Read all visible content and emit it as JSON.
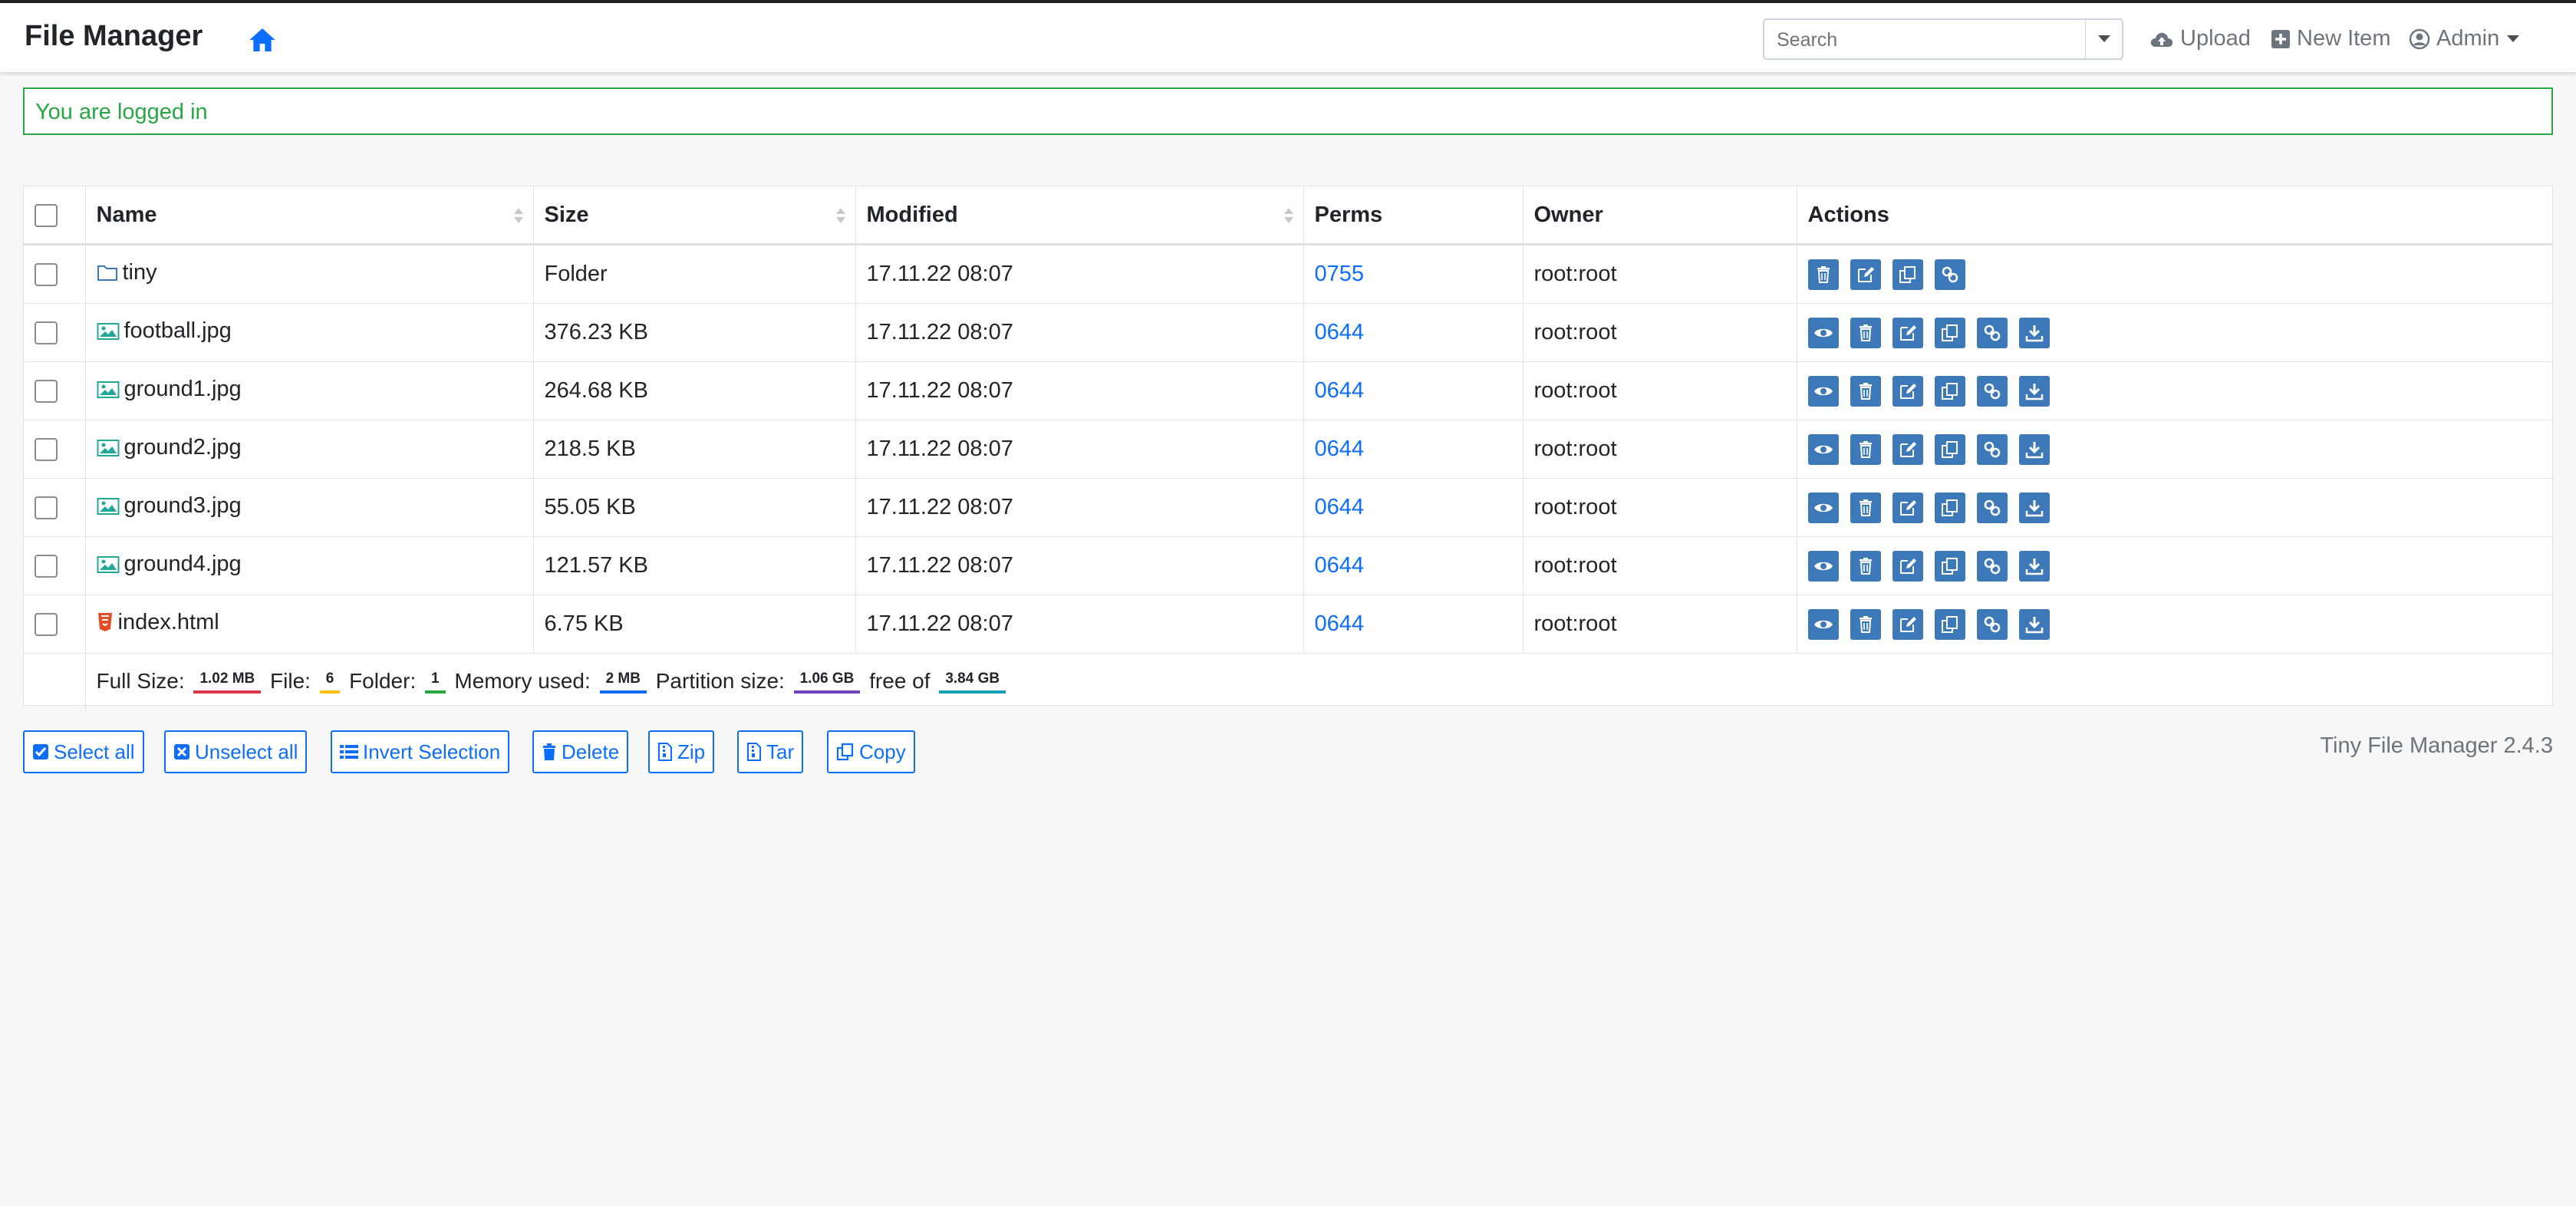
{
  "navbar": {
    "brand": "File Manager",
    "search_placeholder": "Search",
    "upload": "Upload",
    "new_item": "New Item",
    "user": "Admin"
  },
  "alert": {
    "message": "You are logged in"
  },
  "table": {
    "columns": [
      "Name",
      "Size",
      "Modified",
      "Perms",
      "Owner",
      "Actions"
    ],
    "rows": [
      {
        "name": "tiny",
        "type": "folder",
        "size": "Folder",
        "modified": "17.11.22 08:07",
        "perms": "0755",
        "owner": "root:root"
      },
      {
        "name": "football.jpg",
        "type": "image",
        "size": "376.23 KB",
        "modified": "17.11.22 08:07",
        "perms": "0644",
        "owner": "root:root"
      },
      {
        "name": "ground1.jpg",
        "type": "image",
        "size": "264.68 KB",
        "modified": "17.11.22 08:07",
        "perms": "0644",
        "owner": "root:root"
      },
      {
        "name": "ground2.jpg",
        "type": "image",
        "size": "218.5 KB",
        "modified": "17.11.22 08:07",
        "perms": "0644",
        "owner": "root:root"
      },
      {
        "name": "ground3.jpg",
        "type": "image",
        "size": "55.05 KB",
        "modified": "17.11.22 08:07",
        "perms": "0644",
        "owner": "root:root"
      },
      {
        "name": "ground4.jpg",
        "type": "image",
        "size": "121.57 KB",
        "modified": "17.11.22 08:07",
        "perms": "0644",
        "owner": "root:root"
      },
      {
        "name": "index.html",
        "type": "html",
        "size": "6.75 KB",
        "modified": "17.11.22 08:07",
        "perms": "0644",
        "owner": "root:root"
      }
    ],
    "footer": {
      "full_size_label": "Full Size:",
      "full_size": "1.02 MB",
      "file_label": "File:",
      "file_count": "6",
      "folder_label": "Folder:",
      "folder_count": "1",
      "memory_label": "Memory used:",
      "memory": "2 MB",
      "partition_label": "Partition size:",
      "partition": "1.06 GB",
      "free_label": "free of",
      "total": "3.84 GB"
    }
  },
  "bulk_actions": {
    "select_all": "Select all",
    "unselect_all": "Unselect all",
    "invert_selection": "Invert Selection",
    "delete": "Delete",
    "zip": "Zip",
    "tar": "Tar",
    "copy": "Copy"
  },
  "version": "Tiny File Manager 2.4.3",
  "colors": {
    "accent": "#0d6efd",
    "action_button": "#3d78b9",
    "success": "#28a745",
    "badge_full_size": "#dc3545",
    "badge_file": "#ffc107",
    "badge_folder": "#28a745",
    "badge_memory": "#0d6efd",
    "badge_partition": "#6f42c1",
    "badge_total": "#17a2b8"
  }
}
